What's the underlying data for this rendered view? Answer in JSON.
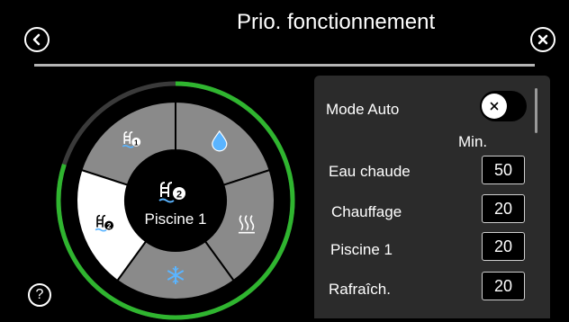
{
  "header": {
    "title": "Prio. fonctionnement",
    "back_icon": "chevron-left-circle-icon",
    "close_icon": "close-circle-icon"
  },
  "dial": {
    "center_label": "Piscine 1",
    "center_icon": "pool-2-icon",
    "progress_fraction": 0.8,
    "segments": [
      {
        "icon": "pool-1-icon",
        "state": "inactive"
      },
      {
        "icon": "water-drop-icon",
        "state": "inactive"
      },
      {
        "icon": "heating-icon",
        "state": "inactive"
      },
      {
        "icon": "snowflake-icon",
        "state": "inactive"
      },
      {
        "icon": "pool-2-icon",
        "state": "active"
      }
    ],
    "colors": {
      "progress": "#2fb52f",
      "track": "#3a3a3a",
      "segment": "#8a8a8a",
      "active": "#ffffff",
      "snowflake": "#5ab4ff",
      "drop": "#5ab4ff"
    }
  },
  "panel": {
    "mode_auto_label": "Mode Auto",
    "mode_auto_on": false,
    "min_header": "Min.",
    "rows": [
      {
        "label": "Eau chaude",
        "value": "50"
      },
      {
        "label": "Chauffage",
        "value": "20"
      },
      {
        "label": "Piscine 1",
        "value": "20"
      },
      {
        "label": "Rafraîch.",
        "value": "20"
      }
    ]
  },
  "footer": {
    "help_icon": "help-icon"
  }
}
